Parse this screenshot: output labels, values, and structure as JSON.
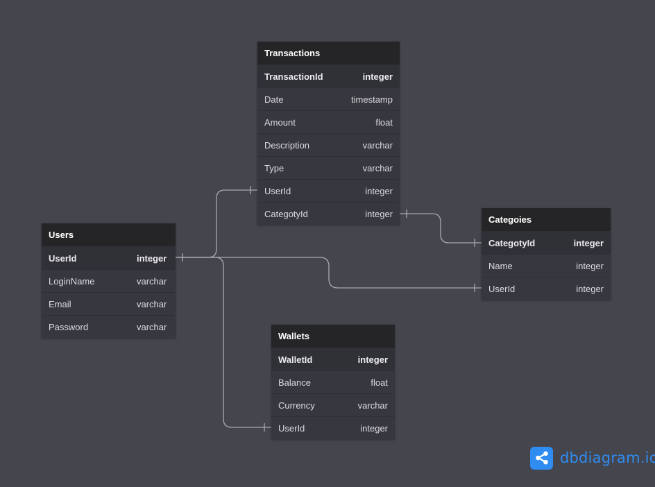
{
  "tables": {
    "transactions": {
      "name": "Transactions",
      "fields": [
        {
          "name": "TransactionId",
          "type": "integer",
          "pk": true
        },
        {
          "name": "Date",
          "type": "timestamp"
        },
        {
          "name": "Amount",
          "type": "float"
        },
        {
          "name": "Description",
          "type": "varchar"
        },
        {
          "name": "Type",
          "type": "varchar"
        },
        {
          "name": "UserId",
          "type": "integer"
        },
        {
          "name": "CategotyId",
          "type": "integer"
        }
      ]
    },
    "users": {
      "name": "Users",
      "fields": [
        {
          "name": "UserId",
          "type": "integer",
          "pk": true
        },
        {
          "name": "LoginName",
          "type": "varchar"
        },
        {
          "name": "Email",
          "type": "varchar"
        },
        {
          "name": "Password",
          "type": "varchar"
        }
      ]
    },
    "categoies": {
      "name": "Categoies",
      "fields": [
        {
          "name": "CategotyId",
          "type": "integer",
          "pk": true
        },
        {
          "name": "Name",
          "type": "integer"
        },
        {
          "name": "UserId",
          "type": "integer"
        }
      ]
    },
    "wallets": {
      "name": "Wallets",
      "fields": [
        {
          "name": "WalletId",
          "type": "integer",
          "pk": true
        },
        {
          "name": "Balance",
          "type": "float"
        },
        {
          "name": "Currency",
          "type": "varchar"
        },
        {
          "name": "UserId",
          "type": "integer"
        }
      ]
    }
  },
  "relationships": [
    {
      "from": "users.UserId",
      "to": "transactions.UserId",
      "type": "one-to-one"
    },
    {
      "from": "users.UserId",
      "to": "categoies.UserId",
      "type": "one-to-one"
    },
    {
      "from": "users.UserId",
      "to": "wallets.UserId",
      "type": "one-to-one"
    },
    {
      "from": "transactions.CategotyId",
      "to": "categoies.CategotyId",
      "type": "one-to-one"
    }
  ],
  "brand": {
    "text": "dbdiagram.io",
    "icon": "share-nodes-icon",
    "color": "#2f8cf0"
  },
  "colors": {
    "background": "#45454e",
    "header": "#252527",
    "row": "#37373f",
    "connector": "#a9a9b0"
  }
}
